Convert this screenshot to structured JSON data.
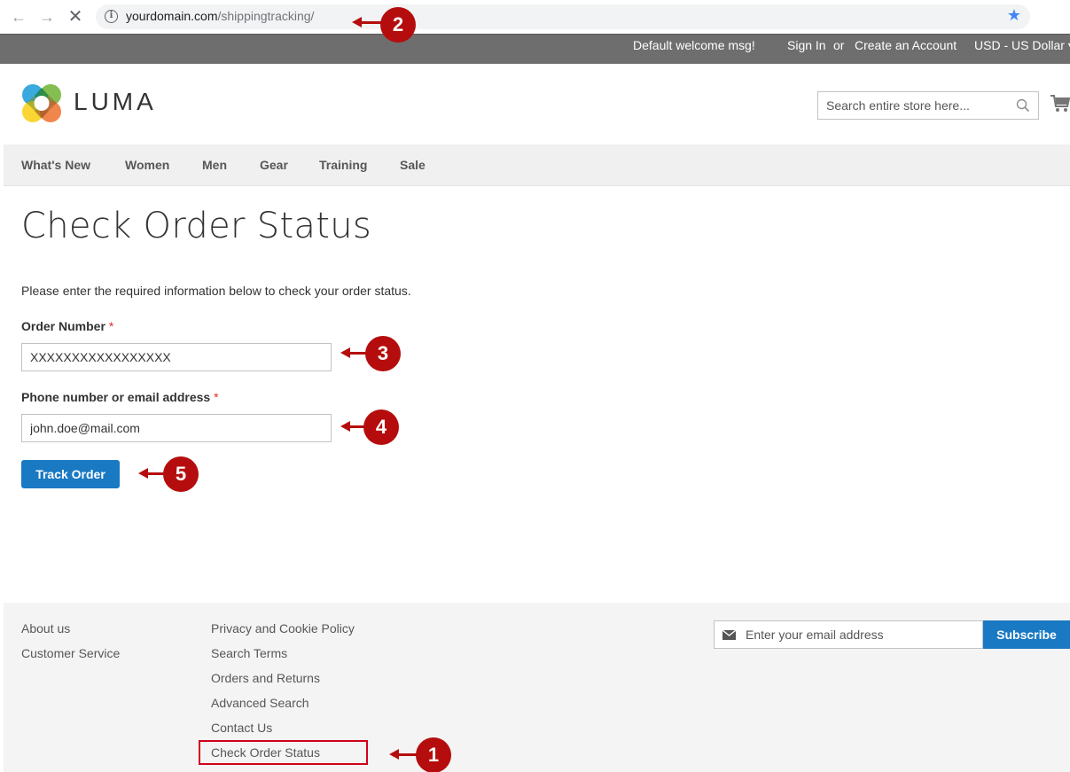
{
  "browser": {
    "url_domain": "yourdomain.com",
    "url_path": "/shippingtracking/",
    "back_icon": "←",
    "forward_icon": "→",
    "stop_icon": "✕",
    "info_icon": "i",
    "star_icon": "★"
  },
  "panel_header": {
    "welcome": "Default welcome msg!",
    "sign_in": "Sign In",
    "or": "or",
    "create_account": "Create an Account",
    "currency": "USD - US Dollar ▾"
  },
  "header": {
    "logo_text": "LUMA",
    "search_placeholder": "Search entire store here..."
  },
  "nav": {
    "items": [
      "What's New",
      "Women",
      "Men",
      "Gear",
      "Training",
      "Sale"
    ]
  },
  "main": {
    "title": "Check Order Status",
    "intro": "Please enter the required information below to check your order status.",
    "order_number_label": "Order Number",
    "order_number_value": "XXXXXXXXXXXXXXXXX",
    "contact_label": "Phone number or email address",
    "contact_value": "john.doe@mail.com",
    "required_mark": "*",
    "track_button": "Track Order"
  },
  "footer": {
    "col1": [
      "About us",
      "Customer Service"
    ],
    "col2": [
      "Privacy and Cookie Policy",
      "Search Terms",
      "Orders and Returns",
      "Advanced Search",
      "Contact Us",
      "Check Order Status"
    ],
    "newsletter_placeholder": "Enter your email address",
    "subscribe_label": "Subscribe"
  },
  "annotations": {
    "step1": "1",
    "step2": "2",
    "step3": "3",
    "step4": "4",
    "step5": "5",
    "color": "#b50d0d"
  },
  "colors": {
    "primary_blue": "#1979c3",
    "panel_gray": "#6e6e6e",
    "required_red": "#e02b27"
  }
}
